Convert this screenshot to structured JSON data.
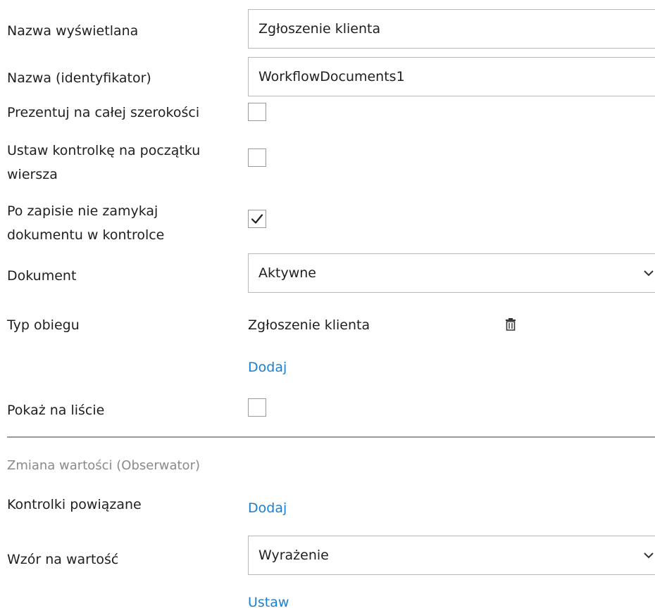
{
  "fields": {
    "display_name": {
      "label": "Nazwa wyświetlana",
      "value": "Zgłoszenie klienta"
    },
    "identifier": {
      "label": "Nazwa (identyfikator)",
      "value": "WorkflowDocuments1"
    },
    "full_width": {
      "label": "Prezentuj na całej szerokości",
      "checked": false
    },
    "line_start": {
      "label_line1": "Ustaw kontrolkę na początku",
      "label_line2": "wiersza",
      "checked": false
    },
    "keep_open": {
      "label_line1": "Po zapisie nie zamykaj",
      "label_line2": "dokumentu w kontrolce",
      "checked": true,
      "check_glyph": "✓"
    },
    "document": {
      "label": "Dokument",
      "selected": "Aktywne"
    },
    "workflow_type": {
      "label": "Typ obiegu",
      "item": "Zgłoszenie klienta",
      "add_link": "Dodaj"
    },
    "show_on_list": {
      "label": "Pokaż na liście",
      "checked": false
    }
  },
  "observer": {
    "section_title": "Zmiana wartości (Obserwator)",
    "linked_controls": {
      "label": "Kontrolki powiązane",
      "add_link": "Dodaj"
    },
    "value_formula": {
      "label": "Wzór na wartość",
      "selected": "Wyrażenie",
      "set_link": "Ustaw"
    }
  },
  "icons": {
    "delete": "trash-icon",
    "dropdown": "chevron-down-icon",
    "check": "checkmark-icon"
  },
  "colors": {
    "link": "#1b7fd1",
    "border": "#b8b8b8",
    "section_text": "#8a8a8a"
  }
}
